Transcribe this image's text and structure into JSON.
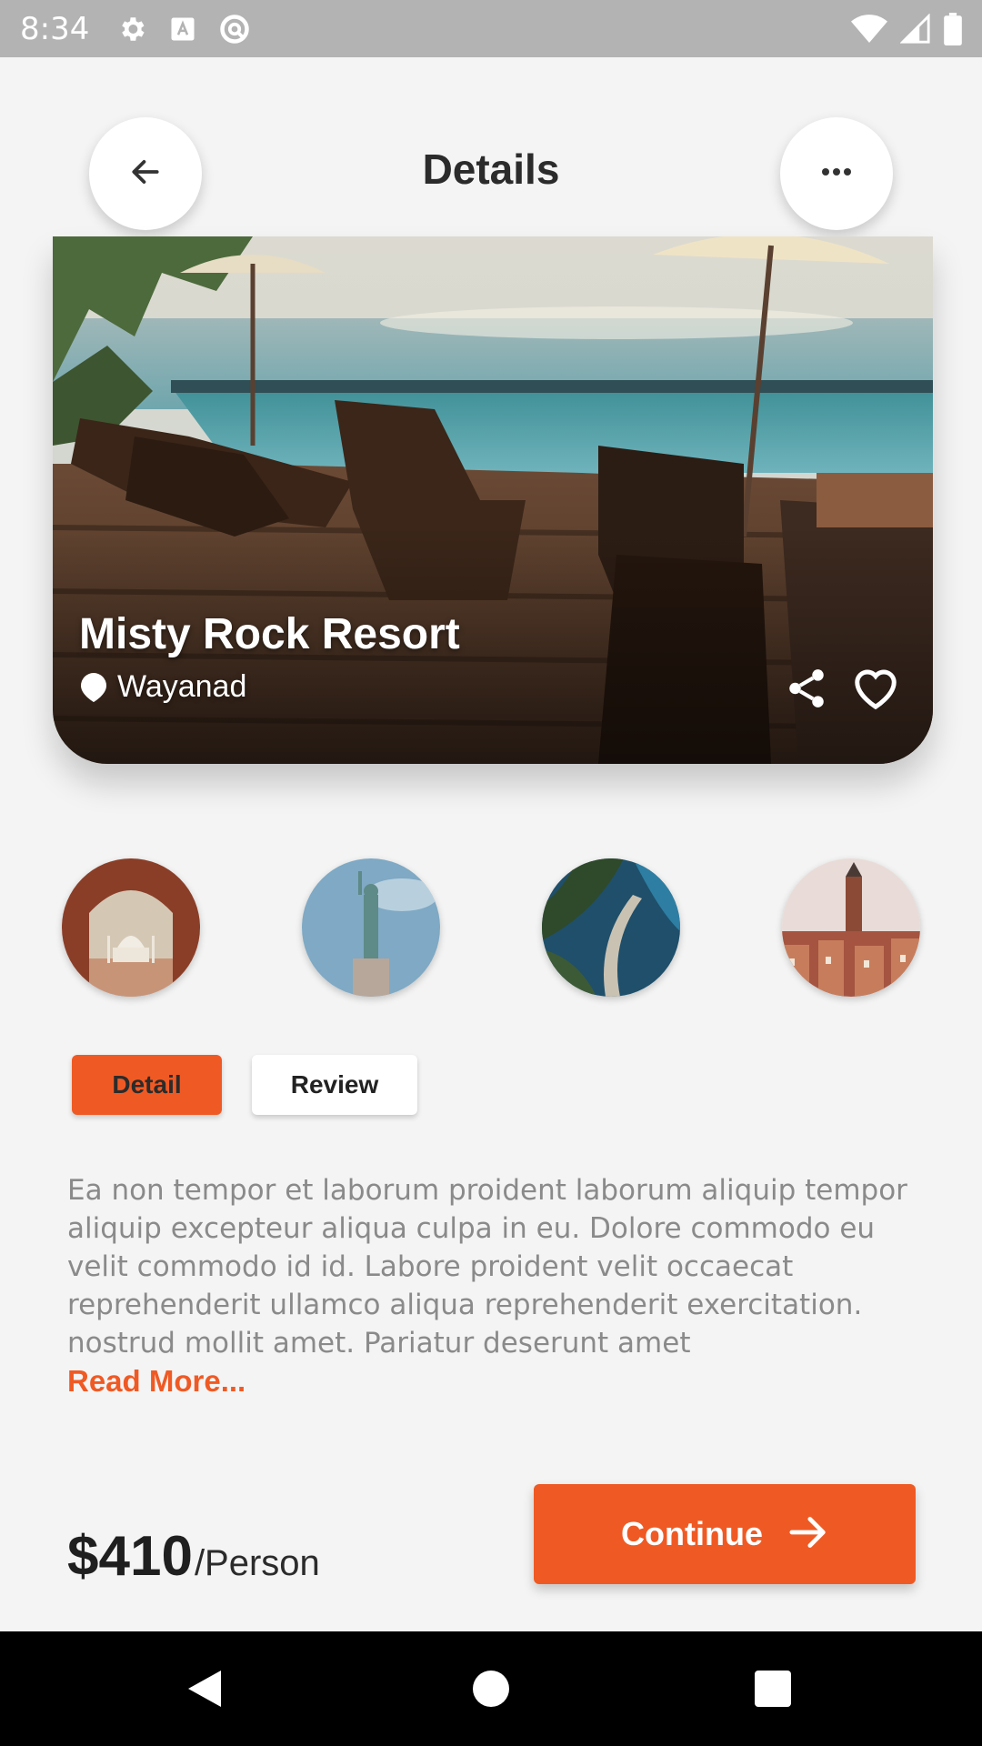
{
  "status_bar": {
    "time": "8:34",
    "left_icons": [
      "gear-icon",
      "text-a-icon",
      "no-disturb-icon"
    ],
    "right_icons": [
      "wifi-icon",
      "cell-signal-icon",
      "battery-icon"
    ]
  },
  "header": {
    "title": "Details",
    "back_icon": "arrow-left-icon",
    "more_icon": "more-horizontal-icon"
  },
  "hero": {
    "name": "Misty Rock Resort",
    "location": "Wayanad",
    "actions": [
      "share-icon",
      "heart-icon"
    ]
  },
  "thumbnails": [
    {
      "name": "taj-mahal-thumbnail"
    },
    {
      "name": "statue-of-liberty-thumbnail"
    },
    {
      "name": "coastal-road-thumbnail"
    },
    {
      "name": "old-town-thumbnail"
    }
  ],
  "tabs": [
    {
      "label": "Detail",
      "active": true
    },
    {
      "label": "Review",
      "active": false
    }
  ],
  "description": {
    "text": "Ea non tempor et laborum proident laborum aliquip tempor aliquip excepteur aliqua culpa in eu. Dolore commodo eu velit commodo id id. Labore proident velit occaecat reprehenderit ullamco aliqua reprehenderit exercitation. nostrud mollit amet. Pariatur deserunt amet",
    "read_more": "Read More..."
  },
  "pricing": {
    "amount": "$410",
    "unit": "/Person"
  },
  "cta": {
    "label": "Continue",
    "icon": "arrow-right-icon"
  },
  "colors": {
    "accent": "#ef5a24",
    "background": "#f4f4f4",
    "status_bar": "#b3b3b3"
  }
}
